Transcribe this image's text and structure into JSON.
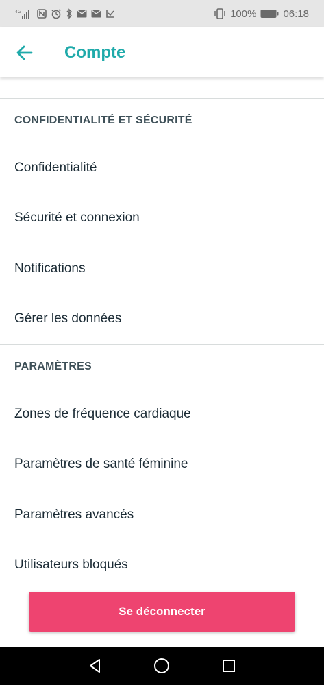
{
  "status_bar": {
    "network": "4G",
    "battery_percent": "100%",
    "time": "06:18",
    "left_icons": [
      "signal-icon",
      "nfc-icon",
      "alarm-icon",
      "bluetooth-icon",
      "mail-icon",
      "mail-icon",
      "mail-icon"
    ],
    "right_icons": [
      "vibrate-icon",
      "battery-icon"
    ]
  },
  "header": {
    "title": "Compte",
    "back_icon": "back-arrow-icon",
    "accent_color": "#1faaaa"
  },
  "sections": [
    {
      "title": "CONFIDENTIALITÉ ET SÉCURITÉ",
      "items": [
        "Confidentialité",
        "Sécurité et connexion",
        "Notifications",
        "Gérer les données"
      ]
    },
    {
      "title": "PARAMÈTRES",
      "items": [
        "Zones de fréquence cardiaque",
        "Paramètres de santé féminine",
        "Paramètres avancés",
        "Utilisateurs bloqués"
      ]
    }
  ],
  "logout": {
    "label": "Se déconnecter",
    "color": "#ee4470"
  },
  "nav_bar": {
    "buttons": [
      "back-triangle-icon",
      "home-circle-icon",
      "recents-square-icon"
    ]
  }
}
